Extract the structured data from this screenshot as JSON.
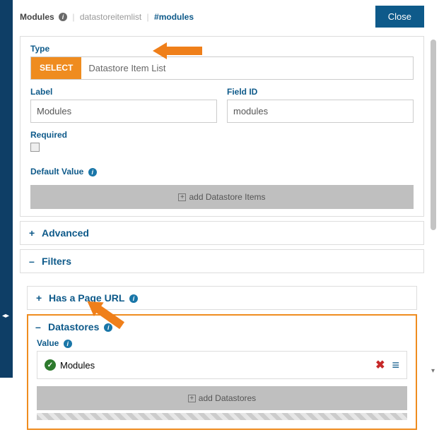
{
  "header": {
    "title": "Modules",
    "crumb_type": "datastoreitemlist",
    "crumb_anchor": "#modules",
    "close_label": "Close"
  },
  "type_section": {
    "label": "Type",
    "select_button": "SELECT",
    "type_value": "Datastore Item List"
  },
  "label_field": {
    "label": "Label",
    "value": "Modules"
  },
  "fieldid_field": {
    "label": "Field ID",
    "value": "modules"
  },
  "required": {
    "label": "Required",
    "checked": false
  },
  "default_value": {
    "label": "Default Value"
  },
  "add_datastore_items_btn": "add Datastore Items",
  "sections": {
    "advanced": "Advanced",
    "filters": "Filters",
    "has_page_url": "Has a Page URL",
    "datastores": "Datastores"
  },
  "datastores": {
    "value_label": "Value",
    "selected_value": "Modules",
    "add_button": "add Datastores"
  }
}
